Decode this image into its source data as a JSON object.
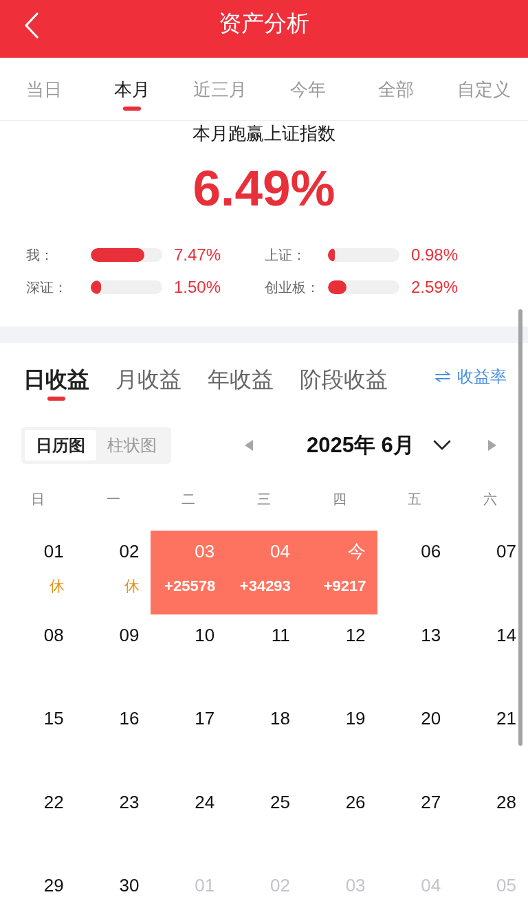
{
  "header": {
    "title": "资产分析"
  },
  "period_tabs": [
    {
      "label": "当日",
      "selected": false
    },
    {
      "label": "本月",
      "selected": true
    },
    {
      "label": "近三月",
      "selected": false
    },
    {
      "label": "今年",
      "selected": false
    },
    {
      "label": "全部",
      "selected": false
    },
    {
      "label": "自定义",
      "selected": false
    }
  ],
  "summary": {
    "title": "本月跑赢上证指数",
    "value": "6.49%"
  },
  "comparisons": [
    {
      "label": "我：",
      "level": 0.75,
      "reading": "7.47%"
    },
    {
      "label": "上证：",
      "level": 0.1,
      "reading": "0.98%"
    },
    {
      "label": "深证：",
      "level": 0.14,
      "reading": "1.50%"
    },
    {
      "label": "创业板：",
      "level": 0.26,
      "reading": "2.59%"
    }
  ],
  "profit_tabs": [
    {
      "label": "日收益",
      "selected": true
    },
    {
      "label": "月收益",
      "selected": false
    },
    {
      "label": "年收益",
      "selected": false
    },
    {
      "label": "阶段收益",
      "selected": false
    }
  ],
  "rate_toggle": {
    "label": "收益率"
  },
  "view_toggle": [
    {
      "label": "日历图",
      "selected": true
    },
    {
      "label": "柱状图",
      "selected": false
    }
  ],
  "month_picker": {
    "label": "2025年 6月"
  },
  "calendar": {
    "weekdays": [
      "日",
      "一",
      "二",
      "三",
      "四",
      "五",
      "六"
    ],
    "weeks": [
      {
        "days": [
          {
            "label": "01",
            "kind": "current",
            "highlighted": false,
            "note": {
              "text": "休",
              "kind": "holiday"
            }
          },
          {
            "label": "02",
            "kind": "current",
            "highlighted": false,
            "note": {
              "text": "休",
              "kind": "holiday"
            }
          },
          {
            "label": "03",
            "kind": "current",
            "highlighted": true,
            "note": {
              "text": "+25578",
              "kind": "gain"
            }
          },
          {
            "label": "04",
            "kind": "current",
            "highlighted": true,
            "note": {
              "text": "+34293",
              "kind": "gain"
            }
          },
          {
            "label": "今",
            "kind": "current",
            "highlighted": true,
            "note": {
              "text": "+9217",
              "kind": "gain"
            }
          },
          {
            "label": "06",
            "kind": "current",
            "highlighted": false
          },
          {
            "label": "07",
            "kind": "current",
            "highlighted": false
          }
        ]
      },
      {
        "days": [
          {
            "label": "08",
            "kind": "current",
            "highlighted": false
          },
          {
            "label": "09",
            "kind": "current",
            "highlighted": false
          },
          {
            "label": "10",
            "kind": "current",
            "highlighted": false
          },
          {
            "label": "11",
            "kind": "current",
            "highlighted": false
          },
          {
            "label": "12",
            "kind": "current",
            "highlighted": false
          },
          {
            "label": "13",
            "kind": "current",
            "highlighted": false
          },
          {
            "label": "14",
            "kind": "current",
            "highlighted": false
          }
        ]
      },
      {
        "days": [
          {
            "label": "15",
            "kind": "current",
            "highlighted": false
          },
          {
            "label": "16",
            "kind": "current",
            "highlighted": false
          },
          {
            "label": "17",
            "kind": "current",
            "highlighted": false
          },
          {
            "label": "18",
            "kind": "current",
            "highlighted": false
          },
          {
            "label": "19",
            "kind": "current",
            "highlighted": false
          },
          {
            "label": "20",
            "kind": "current",
            "highlighted": false
          },
          {
            "label": "21",
            "kind": "current",
            "highlighted": false
          }
        ]
      },
      {
        "days": [
          {
            "label": "22",
            "kind": "current",
            "highlighted": false
          },
          {
            "label": "23",
            "kind": "current",
            "highlighted": false
          },
          {
            "label": "24",
            "kind": "current",
            "highlighted": false
          },
          {
            "label": "25",
            "kind": "current",
            "highlighted": false
          },
          {
            "label": "26",
            "kind": "current",
            "highlighted": false
          },
          {
            "label": "27",
            "kind": "current",
            "highlighted": false
          },
          {
            "label": "28",
            "kind": "current",
            "highlighted": false
          }
        ]
      },
      {
        "days": [
          {
            "label": "29",
            "kind": "current",
            "highlighted": false
          },
          {
            "label": "30",
            "kind": "current",
            "highlighted": false
          },
          {
            "label": "01",
            "kind": "adjacent",
            "highlighted": false
          },
          {
            "label": "02",
            "kind": "adjacent",
            "highlighted": false
          },
          {
            "label": "03",
            "kind": "adjacent",
            "highlighted": false
          },
          {
            "label": "04",
            "kind": "adjacent",
            "highlighted": false
          },
          {
            "label": "05",
            "kind": "adjacent",
            "highlighted": false
          }
        ]
      }
    ]
  }
}
